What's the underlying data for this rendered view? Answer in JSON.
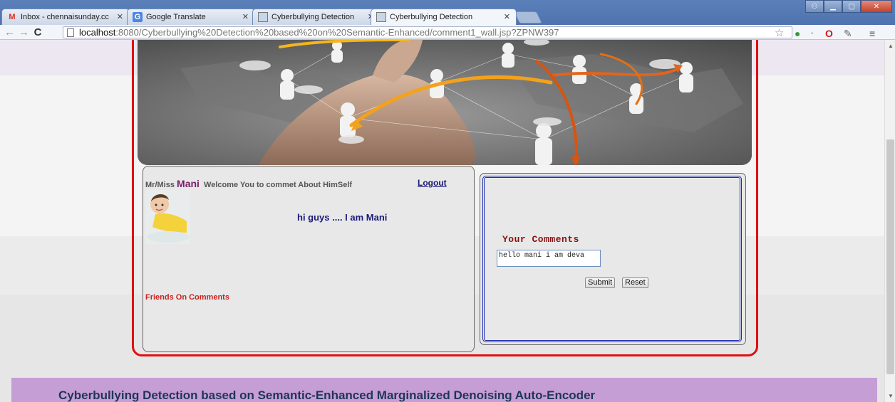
{
  "browser": {
    "tabs": [
      {
        "label": "Inbox - chennaisunday.cc",
        "icon": "gmail-icon",
        "active": false
      },
      {
        "label": "Google Translate",
        "icon": "translate-icon",
        "active": false
      },
      {
        "label": "Cyberbullying Detection",
        "icon": "site-icon",
        "active": false
      },
      {
        "label": "Cyberbullying Detection",
        "icon": "site-icon",
        "active": true
      }
    ],
    "url_host": "localhost",
    "url_rest": ":8080/Cyberbullying%20Detection%20based%20on%20Semantic-Enhanced/comment1_wall.jsp?ZPNW397"
  },
  "profile": {
    "prefix": "Mr/Miss",
    "name": "Mani",
    "welcome": "Welcome You to commet About HimSelf",
    "logout": "Logout",
    "post": "hi guys .... I am Mani",
    "friends_heading": "Friends On Comments"
  },
  "comment_form": {
    "heading": "Your Comments",
    "value": "hello mani i am deva",
    "submit": "Submit",
    "reset": "Reset"
  },
  "footer": {
    "title": "Cyberbullying Detection based on Semantic-Enhanced Marginalized Denoising Auto-Encoder"
  },
  "colors": {
    "frame": "#e01010",
    "inner_border": "#1f2fb0",
    "footer_bg": "#c59ed6"
  }
}
